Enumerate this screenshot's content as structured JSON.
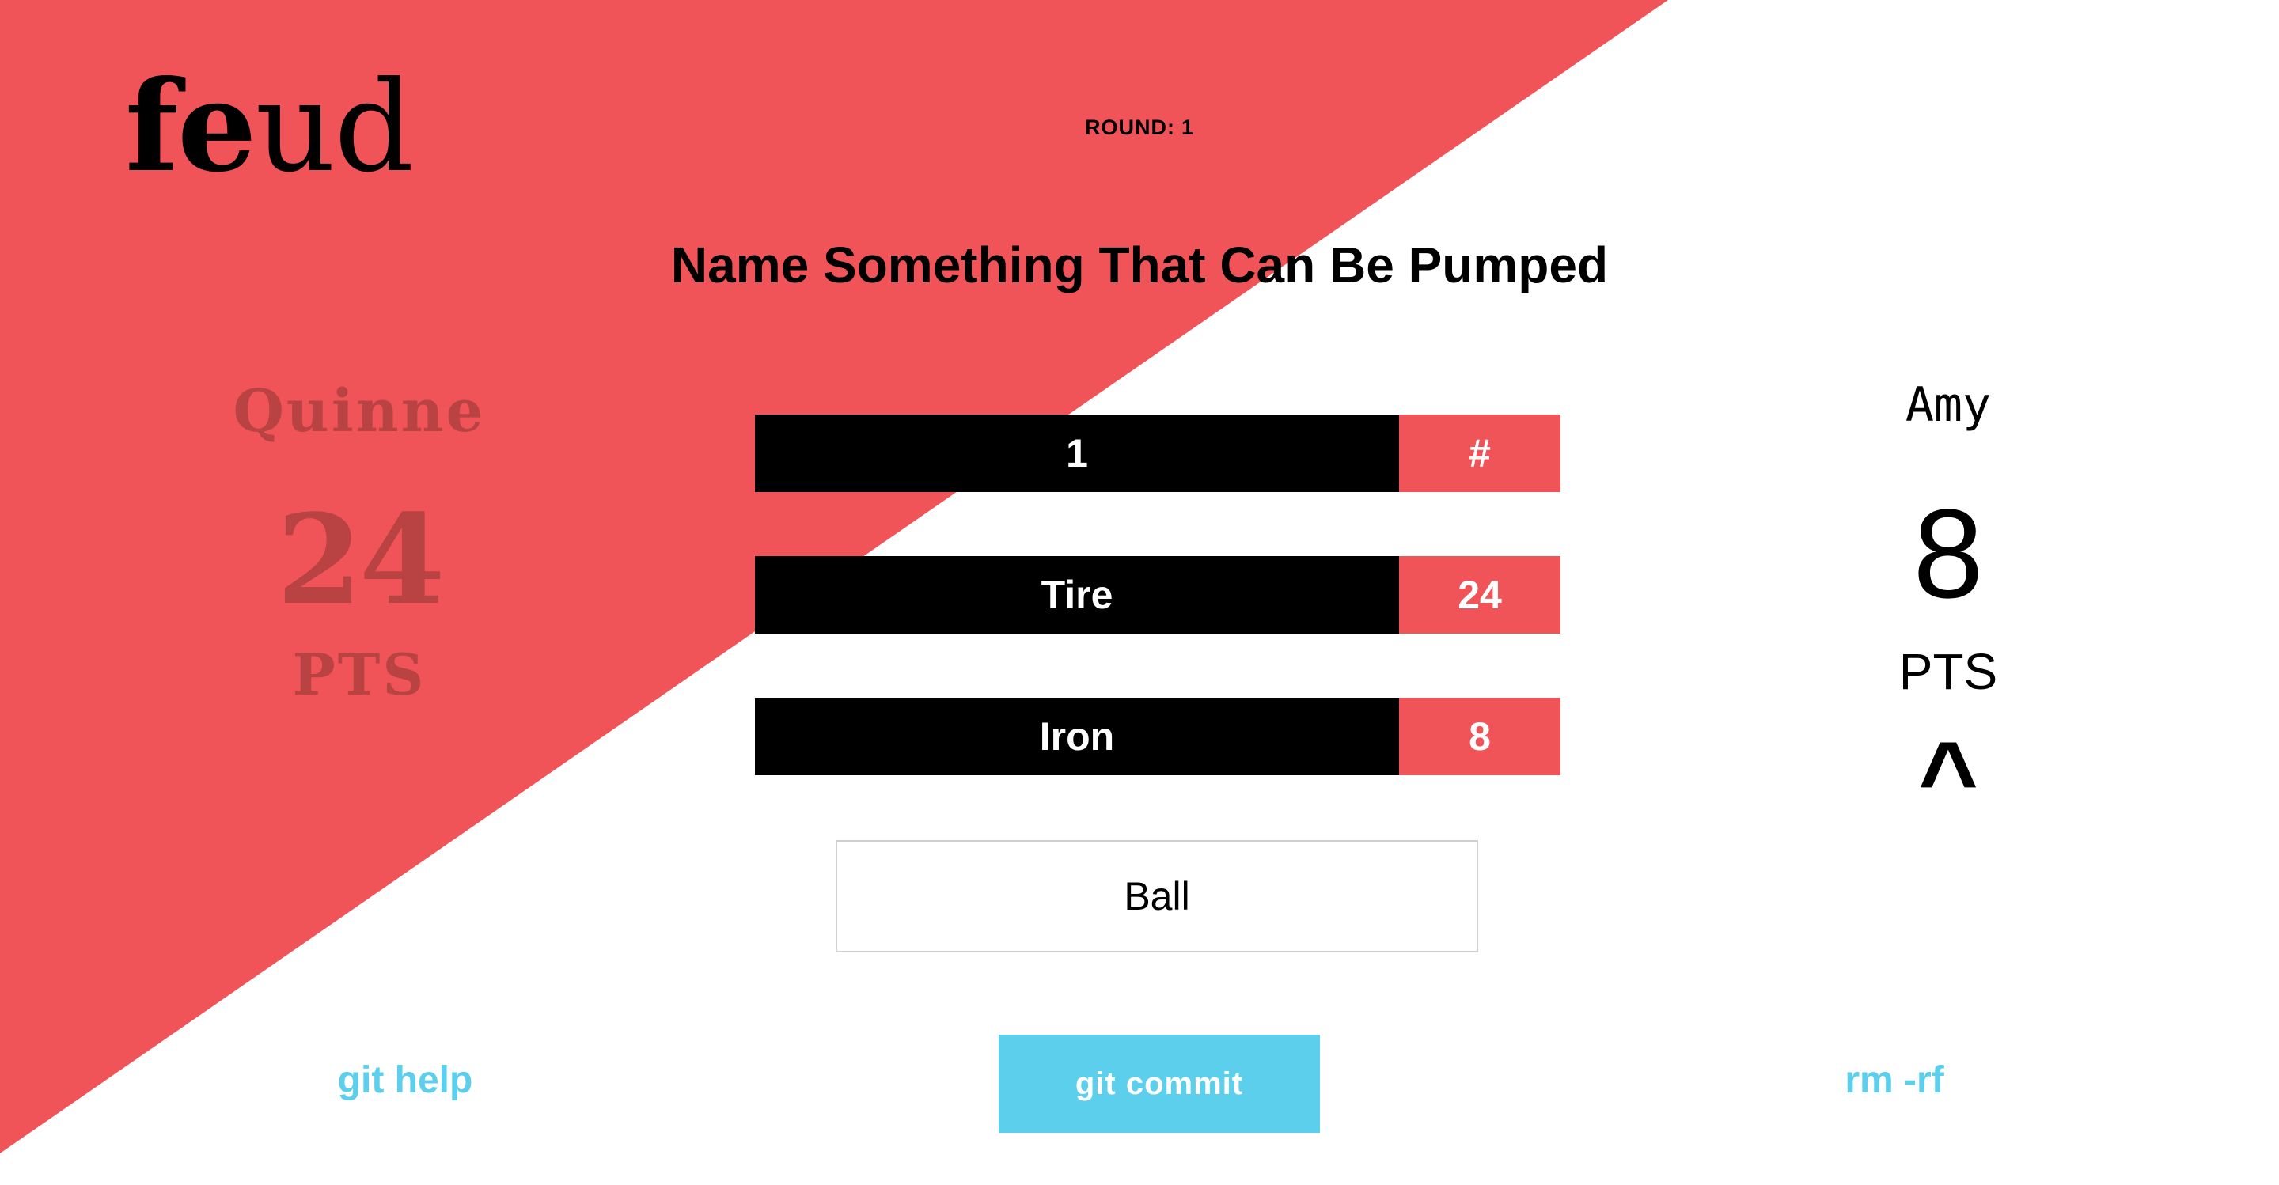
{
  "colors": {
    "accent_red": "#f15458",
    "dark_red_text": "#b94343",
    "cyan": "#5ccfec",
    "black": "#000000",
    "white": "#ffffff"
  },
  "logo": {
    "heavy": "fe",
    "light": "ud"
  },
  "round": {
    "label": "ROUND:",
    "number": "1"
  },
  "question": "Name Something That Can Be Pumped",
  "players": [
    {
      "name": "Quinne",
      "score": "24",
      "unit": "PTS"
    },
    {
      "name": "Amy",
      "score": "8",
      "unit": "PTS"
    }
  ],
  "turn_indicator": "^",
  "answers": [
    {
      "answer": "1",
      "points": "#"
    },
    {
      "answer": "Tire",
      "points": "24"
    },
    {
      "answer": "Iron",
      "points": "8"
    }
  ],
  "guess_input": {
    "value": "Ball"
  },
  "buttons": {
    "help": "git help",
    "commit": "git commit",
    "rm": "rm -rf"
  }
}
